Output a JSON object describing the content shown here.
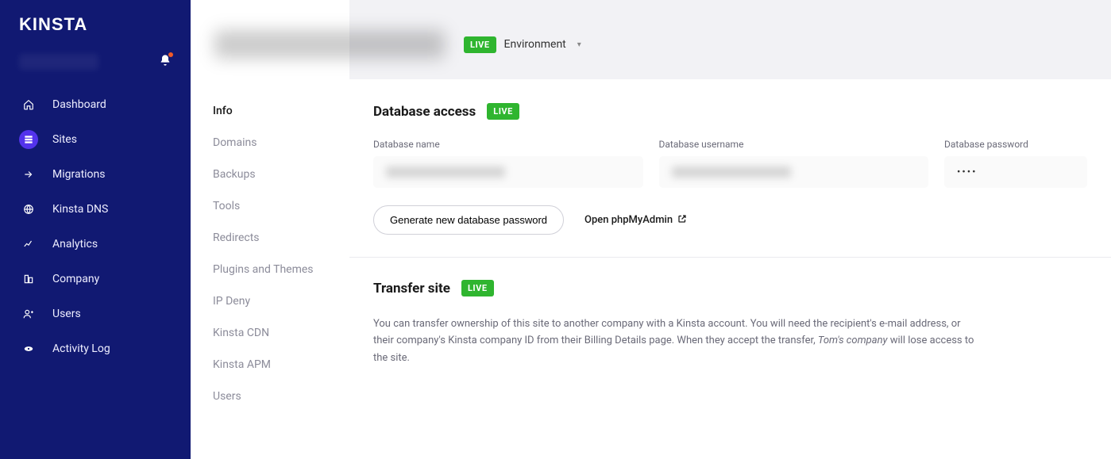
{
  "brand": "KINSTA",
  "nav": {
    "items": [
      {
        "label": "Dashboard",
        "icon": "home"
      },
      {
        "label": "Sites",
        "icon": "sites",
        "active": true
      },
      {
        "label": "Migrations",
        "icon": "migrations"
      },
      {
        "label": "Kinsta DNS",
        "icon": "dns"
      },
      {
        "label": "Analytics",
        "icon": "analytics"
      },
      {
        "label": "Company",
        "icon": "company"
      },
      {
        "label": "Users",
        "icon": "users"
      },
      {
        "label": "Activity Log",
        "icon": "activity"
      }
    ]
  },
  "subnav": {
    "items": [
      {
        "label": "Info",
        "active": true
      },
      {
        "label": "Domains"
      },
      {
        "label": "Backups"
      },
      {
        "label": "Tools"
      },
      {
        "label": "Redirects"
      },
      {
        "label": "Plugins and Themes"
      },
      {
        "label": "IP Deny"
      },
      {
        "label": "Kinsta CDN"
      },
      {
        "label": "Kinsta APM"
      },
      {
        "label": "Users"
      }
    ]
  },
  "header": {
    "live_badge": "LIVE",
    "env_label": "Environment"
  },
  "db": {
    "title": "Database access",
    "badge": "LIVE",
    "name_label": "Database name",
    "user_label": "Database username",
    "pass_label": "Database password",
    "pass_masked": "••••",
    "generate_btn": "Generate new database password",
    "open_php": "Open phpMyAdmin"
  },
  "transfer": {
    "title": "Transfer site",
    "badge": "LIVE",
    "desc_prefix": "You can transfer ownership of this site to another company with a Kinsta account. You will need the recipient's e-mail address, or their company's Kinsta company ID from their Billing Details page. When they accept the transfer, ",
    "company_name": "Tom's company",
    "desc_suffix": " will lose access to the site."
  }
}
